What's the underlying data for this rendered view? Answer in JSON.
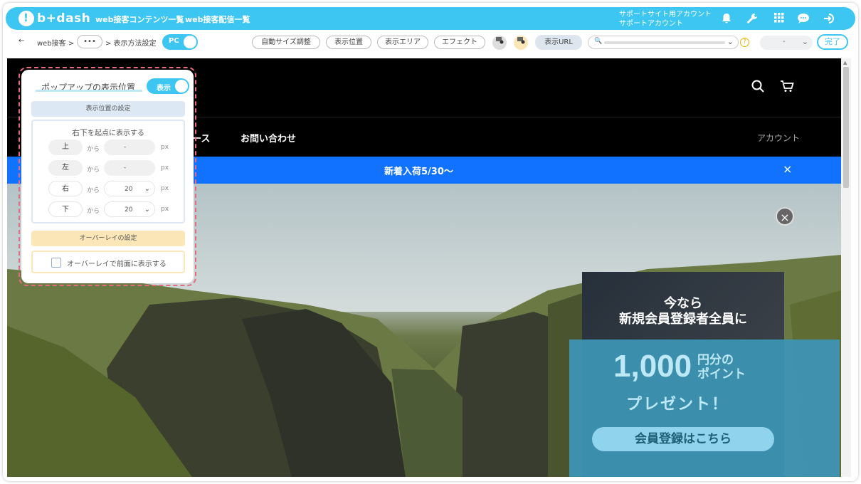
{
  "app": {
    "logo_text": "b+dash"
  },
  "header": {
    "nav": [
      "web接客コンテンツ一覧",
      "web接客配信一覧"
    ],
    "support_line1": "サポートサイト用アカウント",
    "support_line2": "サポートアカウント",
    "icons": [
      "bell-icon",
      "wrench-icon",
      "grid-icon",
      "chat-icon",
      "logout-icon"
    ]
  },
  "toolbar": {
    "back": "←",
    "breadcrumb_root": "web接客 >",
    "breadcrumb_more": "•••",
    "breadcrumb_current": "> 表示方法設定",
    "device_toggle": "PC",
    "buttons": [
      "自動サイズ調整",
      "表示位置",
      "表示エリア",
      "エフェクト"
    ],
    "url_label": "表示URL",
    "url_search_icon": "🔍",
    "select_value": "-",
    "done": "完了"
  },
  "site": {
    "nav": [
      "ース",
      "お問い合わせ"
    ],
    "account": "アカウント",
    "banner_text": "新着入荷5/30〜",
    "banner_close": "×"
  },
  "popup": {
    "line1": "今なら",
    "line2": "新規会員登録者全員に",
    "amount": "1,000",
    "unit_line1": "円分の",
    "unit_line2": "ポイント",
    "present": "プレゼント！",
    "cta": "会員登録はこちら",
    "close": "×"
  },
  "panel": {
    "title": "ポップアップの表示位置",
    "toggle_label": "表示",
    "section_position": "表示位置の設定",
    "origin_prefix": "右下",
    "origin_suffix": "を起点に表示する",
    "rows": [
      {
        "label": "上",
        "from": "から",
        "value": "-",
        "unit": "px"
      },
      {
        "label": "左",
        "from": "から",
        "value": "-",
        "unit": "px"
      },
      {
        "label": "右",
        "from": "から",
        "value": "20",
        "unit": "px"
      },
      {
        "label": "下",
        "from": "から",
        "value": "20",
        "unit": "px"
      }
    ],
    "section_overlay": "オーバーレイの設定",
    "overlay_checkbox": "オーバーレイで前面に表示する"
  },
  "colors": {
    "accent": "#3ec6f2",
    "banner": "#1172ff",
    "outline": "#e86a7f"
  }
}
